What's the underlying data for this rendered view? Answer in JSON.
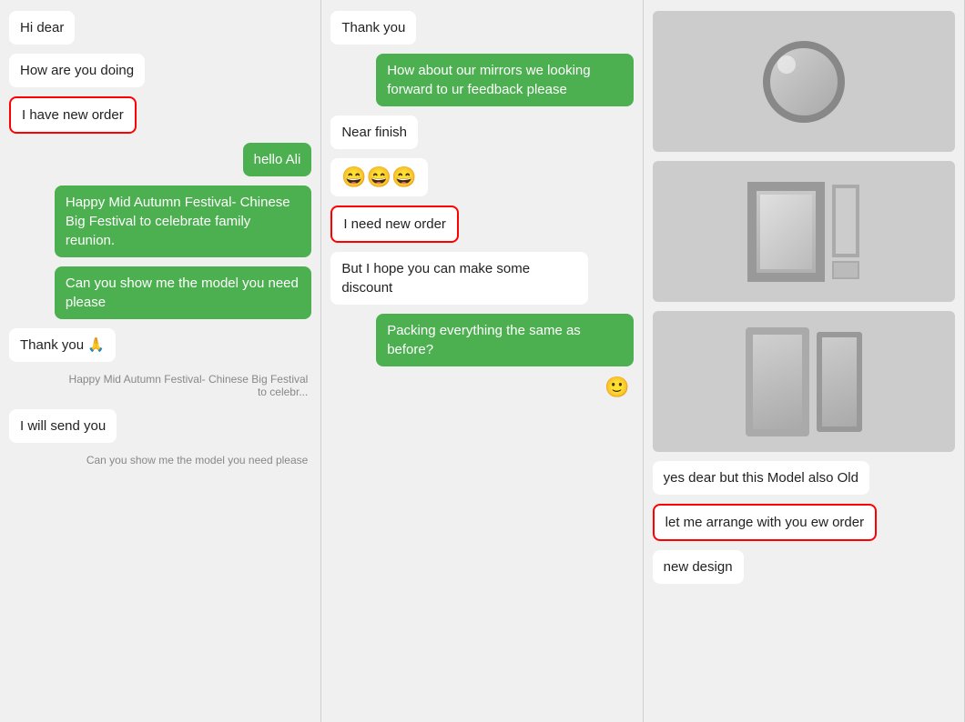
{
  "col1": {
    "messages": [
      {
        "id": "hi-dear",
        "text": "Hi dear",
        "type": "left"
      },
      {
        "id": "how-are",
        "text": "How are you doing",
        "type": "left"
      },
      {
        "id": "have-new-order",
        "text": "I have new order",
        "type": "left",
        "highlighted": true
      },
      {
        "id": "hello-ali",
        "text": "hello Ali",
        "type": "right"
      },
      {
        "id": "mid-autumn",
        "text": "Happy Mid Autumn Festival- Chinese Big Festival to celebrate family reunion.",
        "type": "right"
      },
      {
        "id": "show-model",
        "text": "Can you show me the model you need please",
        "type": "right"
      },
      {
        "id": "thank-you-pray",
        "text": "Thank you 🙏",
        "type": "left"
      },
      {
        "id": "sys-mid-autumn",
        "text": "Happy Mid Autumn Festival- Chinese Big Festival to celebr...",
        "type": "system"
      },
      {
        "id": "will-send",
        "text": "I will send you",
        "type": "left"
      },
      {
        "id": "sys-show-model",
        "text": "Can you show me the model you need please",
        "type": "system"
      }
    ]
  },
  "col2": {
    "messages": [
      {
        "id": "thank-you",
        "text": "Thank you",
        "type": "left"
      },
      {
        "id": "how-about-mirrors",
        "text": "How about our mirrors we looking forward to ur feedback please",
        "type": "right"
      },
      {
        "id": "near-finish",
        "text": "Near finish",
        "type": "left"
      },
      {
        "id": "emoji-row",
        "text": "😄😄😄",
        "type": "emoji"
      },
      {
        "id": "need-new-order",
        "text": "I need new order",
        "type": "left",
        "highlighted": true
      },
      {
        "id": "but-hope",
        "text": "But I hope you can make some discount",
        "type": "left"
      },
      {
        "id": "packing",
        "text": "Packing everything the same as before?",
        "type": "right"
      },
      {
        "id": "sticker",
        "text": "🙂",
        "type": "sticker"
      }
    ]
  },
  "col3": {
    "photos": [
      {
        "id": "photo-1",
        "type": "round-mirror"
      },
      {
        "id": "photo-2",
        "type": "frame-mirror"
      },
      {
        "id": "photo-3",
        "type": "tall-mirror"
      }
    ],
    "messages": [
      {
        "id": "yes-dear",
        "text": "yes dear but this Model also Old",
        "type": "left"
      },
      {
        "id": "arrange-order",
        "text": "let me arrange with you ew order",
        "type": "left",
        "highlighted": true
      },
      {
        "id": "new-design",
        "text": "new design",
        "type": "left"
      }
    ]
  }
}
